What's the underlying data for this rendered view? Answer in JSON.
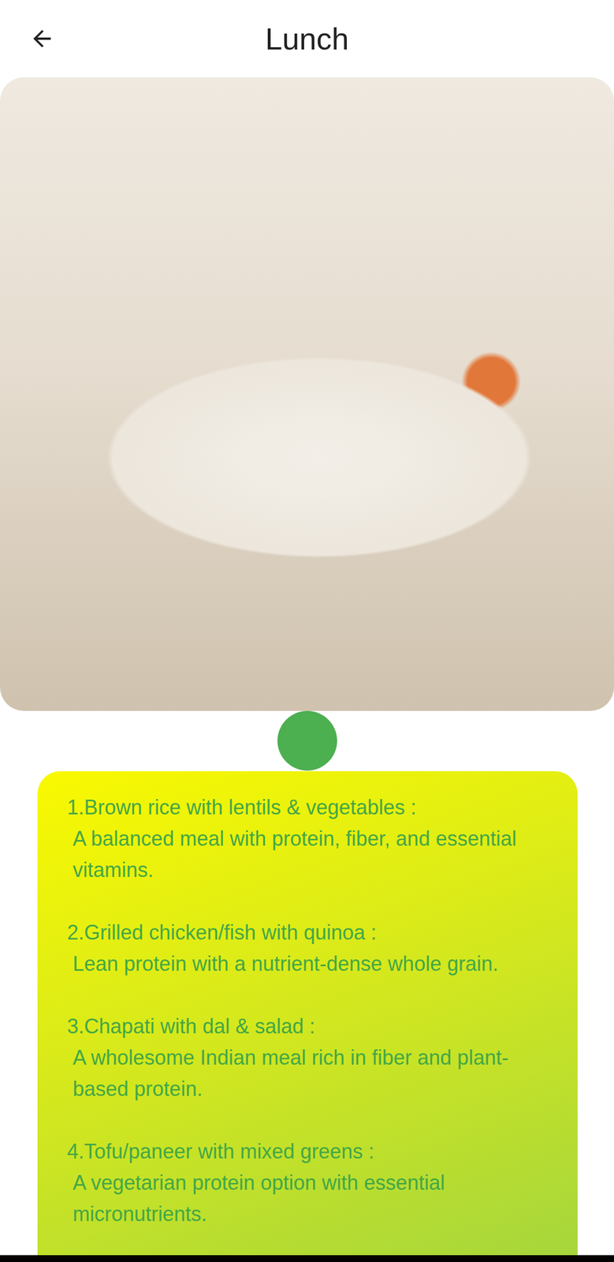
{
  "header": {
    "title": "Lunch"
  },
  "items": [
    {
      "title": "1.Brown rice with lentils & vegetables :",
      "description": "A balanced meal with protein, fiber, and essential vitamins."
    },
    {
      "title": "2.Grilled chicken/fish with quinoa :",
      "description": "Lean protein with a nutrient-dense whole grain."
    },
    {
      "title": "3.Chapati with dal & salad :",
      "description": "A wholesome Indian meal rich in fiber and plant-based protein."
    },
    {
      "title": "4.Tofu/paneer with mixed greens :",
      "description": "A vegetarian protein option with essential micronutrients."
    }
  ]
}
